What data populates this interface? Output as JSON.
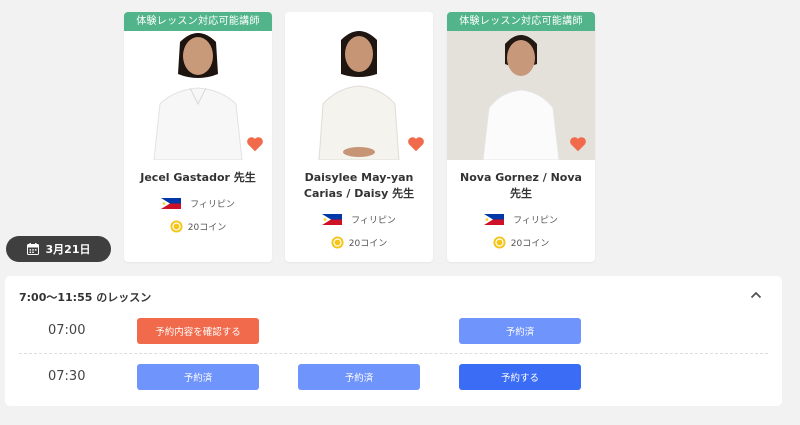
{
  "teachers": [
    {
      "badge": "体験レッスン対応可能講師",
      "name": "Jecel Gastador 先生",
      "country": "フィリピン",
      "coins": "20コイン"
    },
    {
      "badge": "",
      "name": "Daisylee May-yan Carias / Daisy 先生",
      "country": "フィリピン",
      "coins": "20コイン"
    },
    {
      "badge": "体験レッスン対応可能講師",
      "name": "Nova Gornez / Nova 先生",
      "country": "フィリピン",
      "coins": "20コイン"
    }
  ],
  "date_label": "3月21日",
  "lesson_panel": {
    "title": "7:00〜11:55 のレッスン",
    "rows": [
      {
        "time": "07:00",
        "slots": [
          "予約内容を確認する",
          "",
          "予約済"
        ]
      },
      {
        "time": "07:30",
        "slots": [
          "予約済",
          "予約済",
          "予約する"
        ]
      }
    ]
  },
  "colors": {
    "badge_green": "#52b48a",
    "heart": "#f06a4b",
    "confirm_button": "#f06a4b",
    "booked_button": "#6f94fb",
    "book_button": "#3a6cf6",
    "date_pill": "#3f3f3f"
  }
}
